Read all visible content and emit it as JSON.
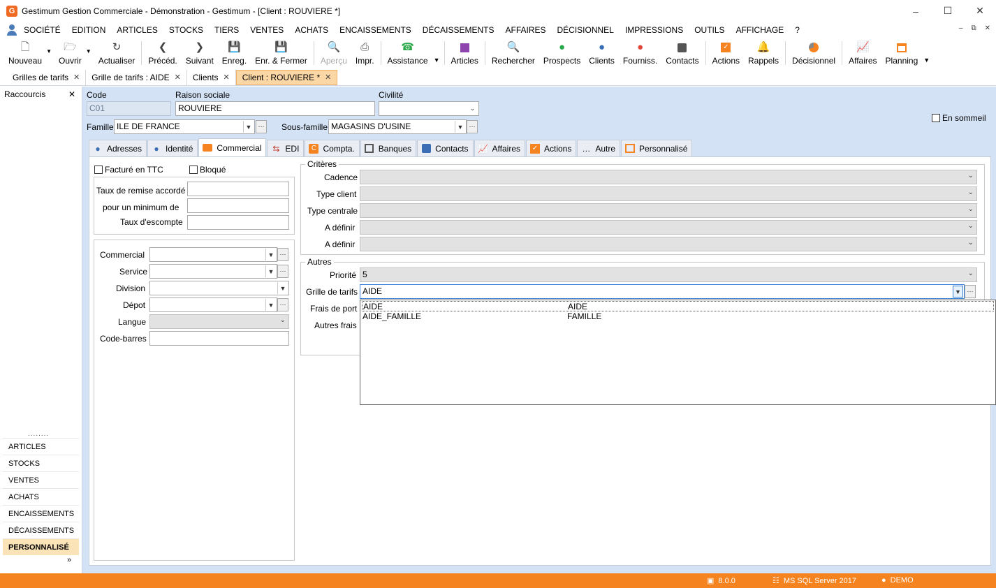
{
  "window": {
    "title": "Gestimum Gestion Commerciale - Démonstration - Gestimum - [Client : ROUVIERE *]",
    "logo_letter": "G"
  },
  "menu": [
    "Société",
    "Edition",
    "Articles",
    "Stocks",
    "Tiers",
    "Ventes",
    "Achats",
    "Encaissements",
    "Décaissements",
    "Affaires",
    "Décisionnel",
    "Impressions",
    "Outils",
    "Affichage",
    "?"
  ],
  "toolbar": {
    "nouveau": "Nouveau",
    "ouvrir": "Ouvrir",
    "actualiser": "Actualiser",
    "preced": "Précéd.",
    "suivant": "Suivant",
    "enreg": "Enreg.",
    "enr_fermer": "Enr. & Fermer",
    "apercu": "Aperçu",
    "impr": "Impr.",
    "assistance": "Assistance",
    "articles": "Articles",
    "rechercher": "Rechercher",
    "prospects": "Prospects",
    "clients": "Clients",
    "fourniss": "Fourniss.",
    "contacts": "Contacts",
    "actions": "Actions",
    "rappels": "Rappels",
    "decisionnel": "Décisionnel",
    "affaires": "Affaires",
    "planning": "Planning"
  },
  "doc_tabs": [
    "Grilles de tarifs",
    "Grille de tarifs : AIDE",
    "Clients",
    "Client : ROUVIERE *"
  ],
  "shortcuts": {
    "title": "Raccourcis",
    "dots": "........",
    "items": [
      "ARTICLES",
      "STOCKS",
      "VENTES",
      "ACHATS",
      "ENCAISSEMENTS",
      "DÉCAISSEMENTS",
      "PERSONNALISÉ"
    ],
    "more": "»"
  },
  "client": {
    "code_label": "Code",
    "code_value": "C01",
    "raison_label": "Raison sociale",
    "raison_value": "ROUVIERE",
    "civilite_label": "Civilité",
    "civilite_value": "",
    "en_sommeil_label": "En sommeil",
    "famille_label": "Famille",
    "famille_value": "ILE DE FRANCE",
    "sous_famille_label": "Sous-famille",
    "sous_famille_value": "MAGASINS D'USINE"
  },
  "inner_tabs": [
    "Adresses",
    "Identité",
    "Commercial",
    "EDI",
    "Compta.",
    "Banques",
    "Contacts",
    "Affaires",
    "Actions",
    "Autre",
    "Personnalisé"
  ],
  "commercial": {
    "facture_ttc": "Facturé en TTC",
    "bloque": "Bloqué",
    "taux_remise": "Taux de remise accordé",
    "minimum": "pour un minimum de",
    "escompte": "Taux d'escompte",
    "commercial": "Commercial",
    "service": "Service",
    "division": "Division",
    "depot": "Dépot",
    "langue": "Langue",
    "code_barres": "Code-barres",
    "criteres_title": "Critères",
    "cadence": "Cadence",
    "type_client": "Type client",
    "type_centrale": "Type centrale",
    "a_definir_1": "A définir",
    "a_definir_2": "A définir",
    "autres_title": "Autres",
    "priorite": "Priorité",
    "priorite_value": "5",
    "grille": "Grille de tarifs",
    "grille_value": "AIDE",
    "frais_port": "Frais de port",
    "autres_frais": "Autres frais"
  },
  "dropdown_rows": [
    {
      "code": "AIDE",
      "name": "AIDE"
    },
    {
      "code": "AIDE_FAMILLE",
      "name": "FAMILLE"
    }
  ],
  "status": {
    "version": "8.0.0",
    "server": "MS SQL Server 2017",
    "user": "DEMO"
  },
  "colors": {
    "accent": "#f5831f",
    "panel_bg": "#d3e2f5",
    "active_tab": "#fbd7a6"
  }
}
